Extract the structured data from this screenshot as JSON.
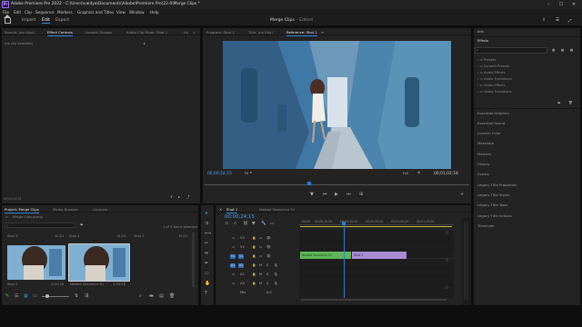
{
  "titlebar": {
    "title": "Adobe Premiere Pro 2022 - C:\\Users\\vaidya\\Documents\\Adobe\\Premiere Pro\\22.0\\Merge Clips *",
    "app_icon": "Pr"
  },
  "menu": [
    "File",
    "Edit",
    "Clip",
    "Sequence",
    "Markers",
    "Graphics and Titles",
    "View",
    "Window",
    "Help"
  ],
  "workspace": {
    "tabs": [
      "Import",
      "Edit",
      "Export"
    ],
    "active": "Edit",
    "center": "Merge Clips",
    "center_status": "- Edited"
  },
  "source_panel": {
    "tabs": [
      "Source: (no clips)",
      "Effect Controls",
      "Lumetri Scopes",
      "Audio Clip Mixer: Shot 1",
      "Au"
    ],
    "active": "Effect Controls",
    "empty_label": "(no clip selected)",
    "timecode": "00;00;24;15"
  },
  "program_panel": {
    "tabs": [
      "Program: Shot 1",
      "Title: (no title)",
      "Reference: Shot 1"
    ],
    "active": "Reference: Shot 1",
    "timecode_left": "00;00;24;15",
    "fit": "Fit",
    "quality": "Full",
    "timecode_right": "00;01;02;18"
  },
  "project_panel": {
    "tabs": [
      "Project: Merge Clips",
      "Media Browser",
      "Libraries"
    ],
    "active": "Project: Merge Clips",
    "file": "Merge Clips.prproj",
    "selection": "1 of 5 items selected",
    "clip_labels_top": [
      {
        "name": "Shot 3",
        "dur": "10;21"
      },
      {
        "name": "Shot 4",
        "dur": "14;24"
      },
      {
        "name": "Shot 2",
        "dur": "15;22"
      }
    ],
    "clips": [
      {
        "name": "Shot 1",
        "dur": "1;03;18"
      },
      {
        "name": "Nested Sequence 01",
        "dur": "1;03;18"
      }
    ]
  },
  "timeline": {
    "tabs": [
      "Shot 1",
      "Nested Sequence 01"
    ],
    "active": "Shot 1",
    "timecode": "00;00;24;15",
    "ruler": [
      ";00;00",
      "00;00;15;00",
      "00;00;30;00",
      "00;00;45;00",
      "00;01;00;00",
      "00;01;15;00"
    ],
    "tracks": [
      "V3",
      "V2",
      "V1",
      "A1",
      "A2",
      "A3",
      "Mix"
    ],
    "clips": [
      {
        "track": "V1",
        "label": "Nested Sequence 01",
        "color": "#5fb65a"
      },
      {
        "track": "V1",
        "label": "Shot 1",
        "color": "#a98bd6"
      }
    ],
    "mix_value": "0.0"
  },
  "right_panel": {
    "info": "Info",
    "effects_title": "Effects",
    "effects_items": [
      "Presets",
      "Lumetri Presets",
      "Audio Effects",
      "Audio Transitions",
      "Video Effects",
      "Video Transitions"
    ],
    "sections": [
      "Essential Graphics",
      "Essential Sound",
      "Lumetri Color",
      "Metadata",
      "Markers",
      "History",
      "Events",
      "Legacy Title Properties",
      "Legacy Title Styles",
      "Legacy Title Tools",
      "Legacy Title Actions",
      "Timecode"
    ]
  },
  "colors": {
    "accent": "#3a8dde",
    "timecode": "#4aa3ff",
    "playhead": "#2b7fd6"
  }
}
